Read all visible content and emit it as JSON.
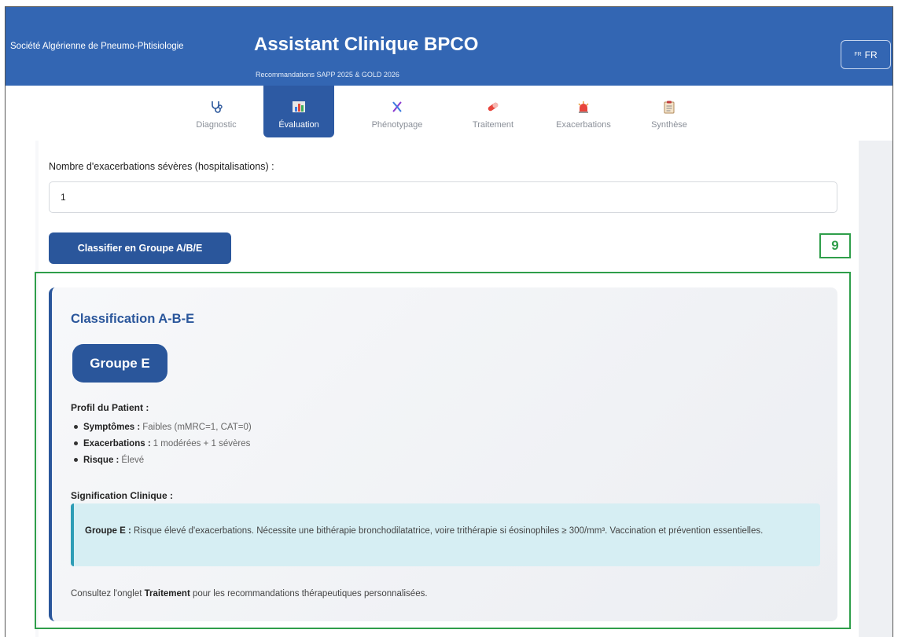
{
  "header": {
    "org_name": "Société Algérienne de Pneumo-Phtisiologie",
    "title": "Assistant Clinique BPCO",
    "subtitle": "Recommandations SAPP 2025 & GOLD 2026",
    "language_flag": "FR",
    "language_label": "FR"
  },
  "tabs": [
    {
      "label": "Diagnostic",
      "icon": "stethoscope-icon"
    },
    {
      "label": "Évaluation",
      "icon": "bar-chart-icon",
      "active": true
    },
    {
      "label": "Phénotypage",
      "icon": "dna-icon"
    },
    {
      "label": "Traitement",
      "icon": "pill-icon"
    },
    {
      "label": "Exacerbations",
      "icon": "siren-icon"
    },
    {
      "label": "Synthèse",
      "icon": "clipboard-icon"
    }
  ],
  "form": {
    "severe_exacerbations_label": "Nombre d'exacerbations sévères (hospitalisations) :",
    "severe_exacerbations_value": "1",
    "classify_button": "Classifier en Groupe A/B/E"
  },
  "annotation": {
    "number": "9",
    "color": "#2f9e4a"
  },
  "result": {
    "title": "Classification A-B-E",
    "group": "Groupe E",
    "profile_title": "Profil du Patient :",
    "profile": [
      {
        "key": "Symptômes :",
        "value": "Faibles (mMRC=1, CAT=0)"
      },
      {
        "key": "Exacerbations :",
        "value": "1 modérées + 1 sévères"
      },
      {
        "key": "Risque :",
        "value": "Élevé"
      }
    ],
    "significance_title": "Signification Clinique :",
    "significance_group": "Groupe E :",
    "significance_text": "Risque élevé d'exacerbations. Nécessite une bithérapie bronchodilatatrice, voire trithérapie si éosinophiles ≥ 300/mm³. Vaccination et prévention essentielles.",
    "footer_prefix": "Consultez l'onglet",
    "footer_link": "Traitement",
    "footer_suffix": "pour les recommandations thérapeutiques personnalisées."
  },
  "colors": {
    "header_bg": "#3366b3",
    "primary": "#2a569b",
    "info_bg": "#d6eef3",
    "info_border": "#2e9db6"
  }
}
